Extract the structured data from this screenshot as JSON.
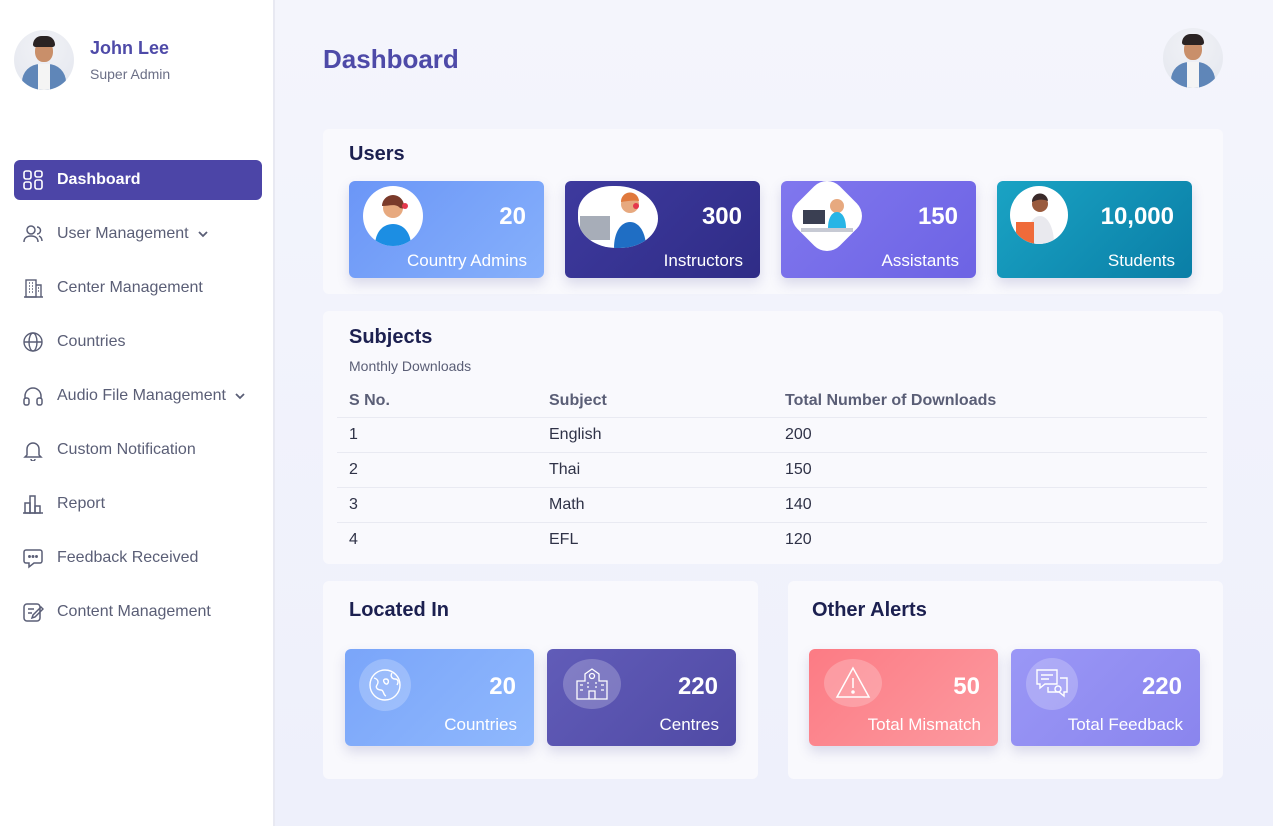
{
  "user": {
    "name": "John Lee",
    "role": "Super Admin"
  },
  "nav": [
    {
      "label": "Dashboard",
      "icon": "grid-icon",
      "active": true
    },
    {
      "label": "User Management",
      "icon": "users-icon",
      "dropdown": true
    },
    {
      "label": "Center Management",
      "icon": "building-icon"
    },
    {
      "label": "Countries",
      "icon": "globe-icon"
    },
    {
      "label": "Audio File Management",
      "icon": "headphones-icon",
      "dropdown": true
    },
    {
      "label": "Custom Notification",
      "icon": "bell-icon"
    },
    {
      "label": "Report",
      "icon": "bar-chart-icon"
    },
    {
      "label": "Feedback Received",
      "icon": "chat-bubble-icon"
    },
    {
      "label": "Content Management",
      "icon": "edit-icon"
    }
  ],
  "page_title": "Dashboard",
  "users": {
    "title": "Users",
    "cards": [
      {
        "value": "20",
        "label": "Country Admins",
        "color": "#6f9af7"
      },
      {
        "value": "300",
        "label": "Instructors",
        "color": "#3b3896"
      },
      {
        "value": "150",
        "label": "Assistants",
        "color": "#7a70ec"
      },
      {
        "value": "10,000",
        "label": "Students",
        "color": "#0f8bb0"
      }
    ]
  },
  "subjects": {
    "title": "Subjects",
    "subtitle": "Monthly Downloads",
    "columns": [
      "S No.",
      "Subject",
      "Total Number of Downloads"
    ],
    "rows": [
      [
        "1",
        "English",
        "200"
      ],
      [
        "2",
        "Thai",
        "150"
      ],
      [
        "3",
        "Math",
        "140"
      ],
      [
        "4",
        "EFL",
        "120"
      ]
    ]
  },
  "located": {
    "title": "Located In",
    "cards": [
      {
        "value": "20",
        "label": "Countries",
        "icon": "earth-icon"
      },
      {
        "value": "220",
        "label": "Centres",
        "icon": "school-building-icon"
      }
    ]
  },
  "alerts": {
    "title": "Other Alerts",
    "cards": [
      {
        "value": "50",
        "label": "Total Mismatch",
        "icon": "warning-icon"
      },
      {
        "value": "220",
        "label": "Total Feedback",
        "icon": "feedback-icon"
      }
    ]
  }
}
